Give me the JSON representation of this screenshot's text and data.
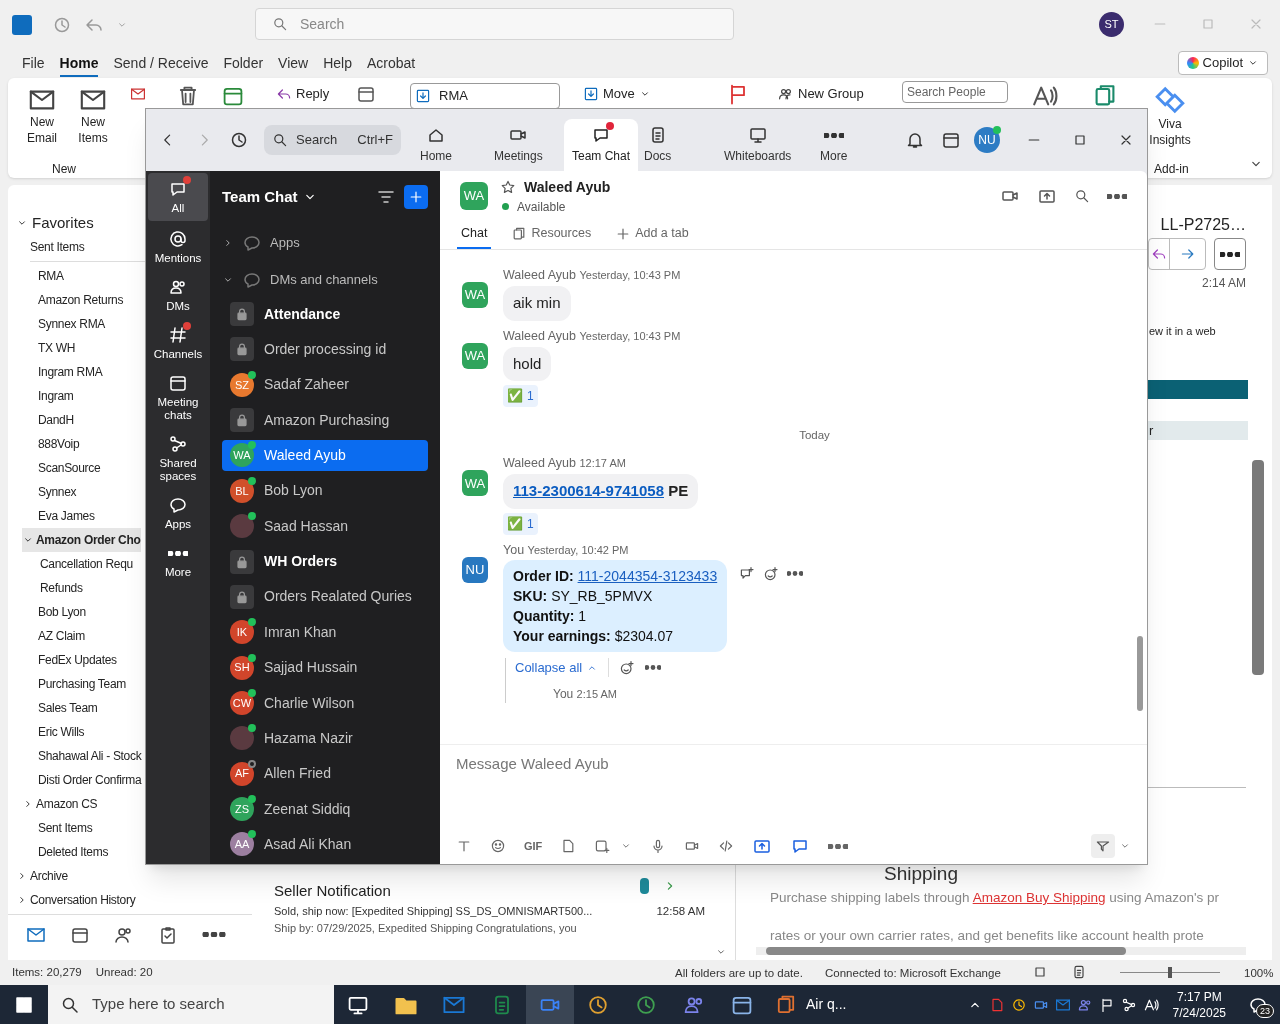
{
  "outlook": {
    "search": {
      "placeholder": "Search"
    },
    "avatar": "ST",
    "menu_tabs": [
      {
        "label": "File",
        "selected": false
      },
      {
        "label": "Home",
        "selected": true
      },
      {
        "label": "Send / Receive",
        "selected": false
      },
      {
        "label": "Folder",
        "selected": false
      },
      {
        "label": "View",
        "selected": false
      },
      {
        "label": "Help",
        "selected": false
      },
      {
        "label": "Acrobat",
        "selected": false
      }
    ],
    "copilot": "Copilot",
    "ribbon": {
      "new_email": "New Email",
      "new_items": "New Items",
      "new_group_label": "New",
      "reply": "Reply",
      "quick_step": "RMA",
      "move": "Move",
      "new_group": "New Group",
      "search_people": {
        "placeholder": "Search People"
      },
      "viva": "Viva Insights",
      "addin_label": "Add-in"
    },
    "folders": {
      "header": "Favorites",
      "expanded": true,
      "items": [
        {
          "kind": "favorite",
          "label": "Sent Items"
        },
        {
          "kind": "folder",
          "label": "RMA"
        },
        {
          "kind": "folder",
          "label": "Amazon Returns"
        },
        {
          "kind": "folder",
          "label": "Synnex RMA"
        },
        {
          "kind": "folder",
          "label": "TX WH"
        },
        {
          "kind": "folder",
          "label": "Ingram RMA"
        },
        {
          "kind": "folder",
          "label": "Ingram"
        },
        {
          "kind": "folder",
          "label": "DandH"
        },
        {
          "kind": "folder",
          "label": "888Voip"
        },
        {
          "kind": "folder",
          "label": "ScanSource"
        },
        {
          "kind": "folder",
          "label": "Synnex"
        },
        {
          "kind": "folder",
          "label": "Eva James"
        },
        {
          "kind": "parent",
          "label": "Amazon Order Cho",
          "expanded": true,
          "selected": true,
          "children": [
            {
              "label": "Cancellation Requ"
            },
            {
              "label": "Refunds"
            }
          ]
        },
        {
          "kind": "folder",
          "label": "Bob Lyon"
        },
        {
          "kind": "folder",
          "label": "AZ Claim"
        },
        {
          "kind": "folder",
          "label": "FedEx Updates"
        },
        {
          "kind": "folder",
          "label": "Purchasing Team"
        },
        {
          "kind": "folder",
          "label": "Sales Team"
        },
        {
          "kind": "folder",
          "label": "Eric Wills"
        },
        {
          "kind": "folder",
          "label": "Shahawal Ali - Stock"
        },
        {
          "kind": "folder",
          "label": "Disti Order Confirma"
        },
        {
          "kind": "parent",
          "label": "Amazon CS",
          "expanded": false
        },
        {
          "kind": "folder",
          "label": "Sent Items"
        },
        {
          "kind": "folder",
          "label": "Deleted Items"
        },
        {
          "kind": "top",
          "label": "Archive",
          "expanded": false
        },
        {
          "kind": "top",
          "label": "Conversation History",
          "expanded": false
        }
      ]
    },
    "message_list": {
      "items": [
        {
          "sender": "Seller Notification",
          "subject": "Sold, ship now: [Expedited Shipping] SS_DS_OMNISMART500...",
          "time": "12:58 AM",
          "preview": "Ship by: 07/29/2025, Expedited Shipping  Congratulations, you"
        }
      ]
    },
    "reading_pane": {
      "subject": "LL-P2725…",
      "time": "2:14 AM",
      "notice": "ew it in a web",
      "row_text": "r",
      "heading": "Shipping",
      "para_1": "Purchase shipping labels through ",
      "link": "Amazon Buy Shipping",
      "para_1_end": " using Amazon's pr",
      "para_2": "rates or your own carrier rates, and get benefits like account health prote"
    },
    "status_bar": {
      "items": "Items: 20,279",
      "unread": "Unread: 20",
      "sync": "All folders are up to date.",
      "connection": "Connected to: Microsoft Exchange",
      "zoom": "100%",
      "zoom_slider": {
        "level": 0.5
      }
    }
  },
  "zoom": {
    "search": {
      "placeholder": "Search",
      "shortcut": "Ctrl+F"
    },
    "tabs": [
      {
        "label": "Home",
        "selected": false
      },
      {
        "label": "Meetings",
        "selected": false
      },
      {
        "label": "Team Chat",
        "selected": true,
        "badge": true
      },
      {
        "label": "Docs",
        "selected": false
      },
      {
        "label": "Whiteboards",
        "selected": false
      },
      {
        "label": "More",
        "selected": false
      }
    ],
    "avatar": "NU",
    "rail": [
      {
        "label": "All",
        "selected": true,
        "badge": true
      },
      {
        "label": "Mentions",
        "selected": false,
        "badge": false
      },
      {
        "label": "DMs",
        "selected": false,
        "badge": false
      },
      {
        "label": "Channels",
        "selected": false,
        "badge": true
      },
      {
        "label": "Meeting chats",
        "selected": false,
        "badge": false
      },
      {
        "label": "Shared spaces",
        "selected": false,
        "badge": false
      },
      {
        "label": "Apps",
        "selected": false,
        "badge": false
      },
      {
        "label": "More",
        "selected": false,
        "badge": false
      }
    ],
    "list_title": "Team Chat",
    "sections": [
      {
        "label": "Apps",
        "expanded": false
      },
      {
        "label": "DMs and channels",
        "expanded": true
      }
    ],
    "chats": [
      {
        "kind": "channel",
        "name": "Attendance",
        "unread": true,
        "selected": false
      },
      {
        "kind": "channel",
        "name": "Order processing id",
        "unread": false,
        "selected": false
      },
      {
        "kind": "person",
        "name": "Sadaf Zaheer",
        "initials": "SZ",
        "color": "#e8792f",
        "online": true,
        "unread": false,
        "selected": false
      },
      {
        "kind": "channel",
        "name": "Amazon Purchasing",
        "unread": false,
        "selected": false
      },
      {
        "kind": "person",
        "name": "Waleed Ayub",
        "initials": "WA",
        "color": "#2fa45c",
        "online": true,
        "unread": false,
        "selected": true
      },
      {
        "kind": "person",
        "name": "Bob Lyon",
        "initials": "BL",
        "color": "#d1502b",
        "online": true,
        "unread": false,
        "selected": false
      },
      {
        "kind": "photo",
        "name": "Saad Hassan",
        "online": true,
        "unread": false,
        "selected": false
      },
      {
        "kind": "channel",
        "name": "WH Orders",
        "unread": true,
        "selected": false
      },
      {
        "kind": "channel",
        "name": "Orders Realated Quries",
        "unread": false,
        "selected": false
      },
      {
        "kind": "person",
        "name": "Imran Khan",
        "initials": "IK",
        "color": "#d1452b",
        "online": true,
        "unread": false,
        "selected": false
      },
      {
        "kind": "person",
        "name": "Sajjad Hussain",
        "initials": "SH",
        "color": "#d1452b",
        "online": true,
        "unread": false,
        "selected": false
      },
      {
        "kind": "person",
        "name": "Charlie Wilson",
        "initials": "CW",
        "color": "#d1452b",
        "online": true,
        "unread": false,
        "selected": false
      },
      {
        "kind": "photo",
        "name": "Hazama Nazir",
        "online": true,
        "unread": false,
        "selected": false
      },
      {
        "kind": "person",
        "name": "Allen Fried",
        "initials": "AF",
        "color": "#d1452b",
        "online": false,
        "unread": false,
        "selected": false
      },
      {
        "kind": "person",
        "name": "Zeenat Siddiq",
        "initials": "ZS",
        "color": "#2fa45c",
        "online": true,
        "unread": false,
        "selected": false
      },
      {
        "kind": "person",
        "name": "Asad Ali Khan",
        "initials": "AA",
        "color": "#9c7fa0",
        "online": true,
        "unread": false,
        "selected": false
      }
    ],
    "chat": {
      "initials": "WA",
      "name": "Waleed Ayub",
      "status": "Available",
      "tabs": [
        {
          "label": "Chat",
          "selected": true
        },
        {
          "label": "Resources",
          "selected": false
        },
        {
          "label": "Add a tab",
          "selected": false
        }
      ],
      "messages": [
        {
          "kind": "message",
          "sender": "Waleed Ayub",
          "time": "Yesterday, 10:43 PM",
          "initials": "WA",
          "mine": false,
          "text": "aik min"
        },
        {
          "kind": "message",
          "sender": "Waleed Ayub",
          "time": "Yesterday, 10:43 PM",
          "initials": "WA",
          "mine": false,
          "text": "hold",
          "reaction": {
            "emoji": "✅",
            "count": "1"
          }
        },
        {
          "kind": "date_divider",
          "text": "Today"
        },
        {
          "kind": "message",
          "sender": "Waleed Ayub",
          "time": "12:17 AM",
          "initials": "WA",
          "mine": false,
          "link": "113-2300614-9741058",
          "text": "PE",
          "reaction": {
            "emoji": "✅",
            "count": "1"
          }
        },
        {
          "kind": "order",
          "sender": "You",
          "time": "Yesterday, 10:42 PM",
          "initials": "NU",
          "mine": true,
          "fields": [
            {
              "label": "Order ID:",
              "link": "111-2044354-3123433"
            },
            {
              "label": "SKU:",
              "value": "SY_RB_5PMVX"
            },
            {
              "label": "Quantity:",
              "value": "1"
            },
            {
              "label": "Your earnings:",
              "value": "$2304.07"
            }
          ],
          "thread": {
            "collapse": "Collapse all",
            "reply_sender": "You",
            "reply_time": "2:15 AM"
          }
        }
      ],
      "composer": {
        "placeholder": "Message Waleed Ayub",
        "gif": "GIF"
      }
    }
  },
  "taskbar": {
    "search": {
      "placeholder": "Type here to search"
    },
    "weather": "Air q...",
    "time": "7:17 PM",
    "date": "7/24/2025",
    "notifications": "23"
  }
}
